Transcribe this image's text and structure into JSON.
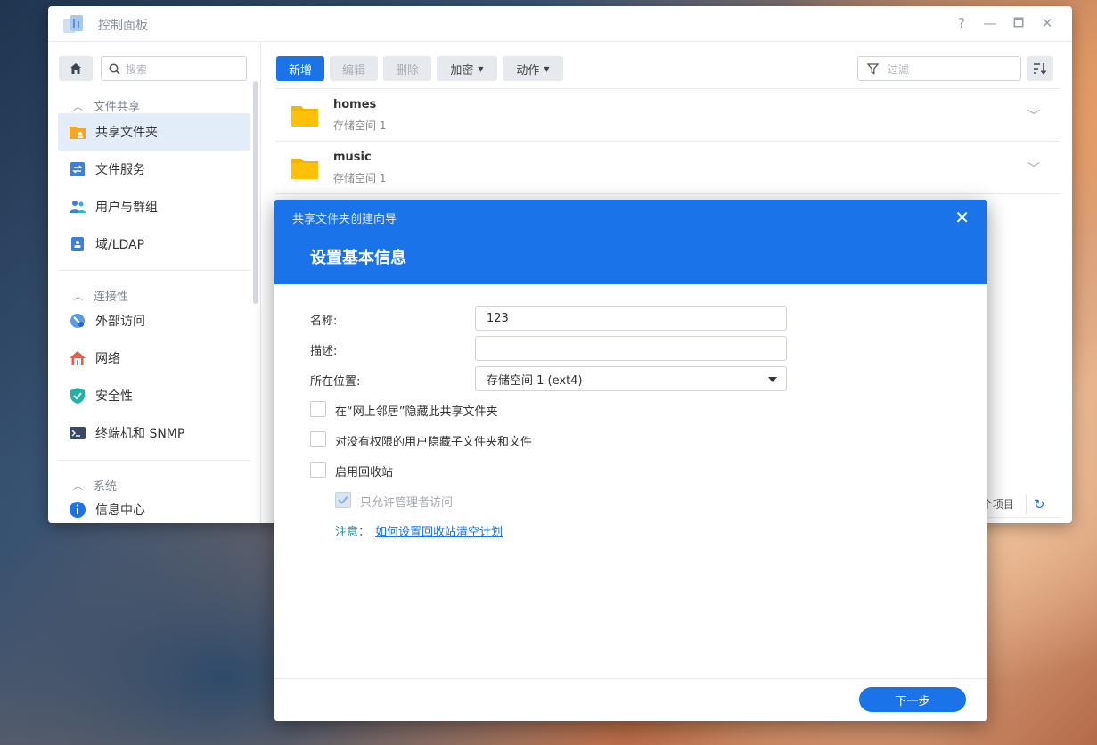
{
  "window": {
    "title": "控制面板",
    "controls": [
      "?",
      "—",
      "🗖",
      "✕"
    ]
  },
  "sidebar": {
    "search_placeholder": "搜索",
    "sections": [
      {
        "title": "文件共享",
        "items": [
          {
            "label": "共享文件夹",
            "icon": "shared-folder-icon",
            "active": true
          },
          {
            "label": "文件服务",
            "icon": "file-services-icon"
          },
          {
            "label": "用户与群组",
            "icon": "users-groups-icon"
          },
          {
            "label": "域/LDAP",
            "icon": "domain-ldap-icon"
          }
        ]
      },
      {
        "title": "连接性",
        "items": [
          {
            "label": "外部访问",
            "icon": "external-access-icon"
          },
          {
            "label": "网络",
            "icon": "network-icon"
          },
          {
            "label": "安全性",
            "icon": "security-shield-icon"
          },
          {
            "label": "终端机和 SNMP",
            "icon": "terminal-icon"
          }
        ]
      },
      {
        "title": "系统",
        "items": [
          {
            "label": "信息中心",
            "icon": "info-icon"
          }
        ]
      }
    ]
  },
  "toolbar": {
    "create": "新增",
    "edit": "编辑",
    "delete": "删除",
    "encrypt": "加密",
    "action": "动作",
    "filter_placeholder": "过滤"
  },
  "folders": [
    {
      "name": "homes",
      "location": "存储空间 1"
    },
    {
      "name": "music",
      "location": "存储空间 1"
    }
  ],
  "footer": {
    "count_text": "个项目"
  },
  "wizard": {
    "title": "共享文件夹创建向导",
    "step_title": "设置基本信息",
    "name_label": "名称:",
    "name_value": "123",
    "desc_label": "描述:",
    "desc_value": "",
    "location_label": "所在位置:",
    "location_value": "存储空间 1 (ext4)",
    "hide_network": "在“网上邻居”隐藏此共享文件夹",
    "hide_subfolders": "对没有权限的用户隐藏子文件夹和文件",
    "enable_recycle": "启用回收站",
    "admin_only": "只允许管理者访问",
    "note_label": "注意：",
    "note_link": "如何设置回收站清空计划",
    "next_button": "下一步"
  },
  "colors": {
    "accent": "#1a73e8",
    "folder": "#f5b400"
  }
}
